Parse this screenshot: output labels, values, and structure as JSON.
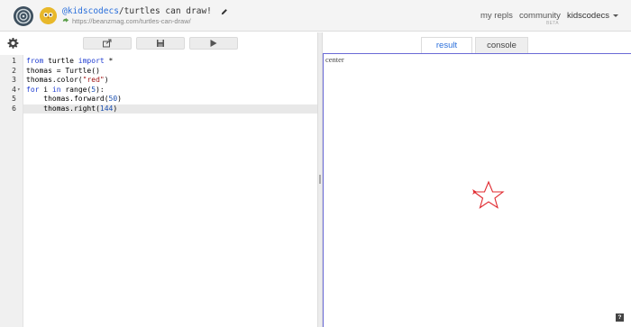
{
  "header": {
    "owner": "@kidscodecs",
    "separator": "/",
    "repl_name": "turtles can draw!",
    "url": "https://beanzmag.com/turtles-can-draw/",
    "nav": {
      "my_repls": "my repls",
      "community": "community",
      "community_badge": "BETA",
      "user": "kidscodecs"
    }
  },
  "editor": {
    "line_numbers": [
      "1",
      "2",
      "3",
      "4",
      "5",
      "6"
    ],
    "fold_marker": "▾",
    "lines": {
      "l1": {
        "kw1": "from",
        "mid": " turtle ",
        "kw2": "import",
        "rest": " *"
      },
      "l2": {
        "text": "thomas = Turtle()"
      },
      "l3": {
        "pre": "thomas.color(",
        "str": "\"red\"",
        "post": ")"
      },
      "l4": {
        "kw1": "for",
        "mid": " i ",
        "kw2": "in",
        "pre": " range(",
        "num": "5",
        "post": "):"
      },
      "l5": {
        "pre": "    thomas.forward(",
        "num": "50",
        "post": ")"
      },
      "l6": {
        "pre": "    thomas.right(",
        "num": "144",
        "post": ")"
      }
    },
    "active_line": 6
  },
  "result": {
    "tabs": [
      "result",
      "console"
    ],
    "active_tab": "result",
    "canvas_label": "center",
    "turtle_color": "#e0282e",
    "help_label": "?"
  },
  "icons": {
    "settings": "gear-icon",
    "export": "share-icon",
    "save": "save-icon",
    "run": "play-icon"
  },
  "colors": {
    "accent": "#2a6fdb",
    "keyword": "#1f3cd1",
    "string": "#a01515",
    "turtle": "#e0282e",
    "canvas_border": "#6b6bd6"
  }
}
